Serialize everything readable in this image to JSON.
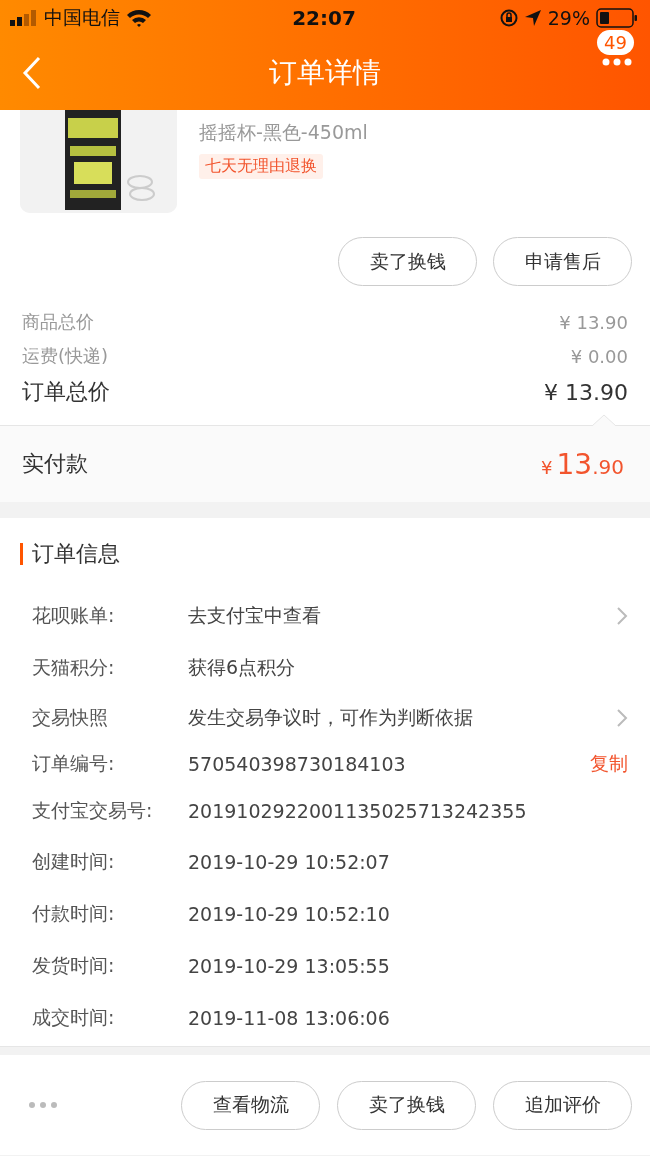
{
  "status_bar": {
    "carrier": "中国电信",
    "time": "22:07",
    "battery": "29%"
  },
  "nav": {
    "title": "订单详情",
    "badge": "49"
  },
  "product": {
    "spec": "摇摇杯-黑色-450ml",
    "tag": "七天无理由退换"
  },
  "item_buttons": [
    "卖了换钱",
    "申请售后"
  ],
  "price_rows": [
    {
      "kind": "minor",
      "label": "商品总价",
      "value": "¥ 13.90"
    },
    {
      "kind": "minor",
      "label": "运费(快递)",
      "value": "¥ 0.00"
    },
    {
      "kind": "major",
      "label": "订单总价",
      "value": "¥ 13.90"
    }
  ],
  "paid": {
    "label": "实付款",
    "currency": "¥",
    "integer": "13",
    "decimal": ".90"
  },
  "order_info": {
    "title": "订单信息",
    "rows": [
      {
        "kind": "chevron",
        "label": "花呗账单:",
        "value": "去支付宝中查看"
      },
      {
        "kind": "plain",
        "label": "天猫积分:",
        "value": "获得6点积分"
      },
      {
        "kind": "chevron",
        "label": "交易快照",
        "value": "发生交易争议时，可作为判断依据"
      },
      {
        "kind": "copy",
        "label": "订单编号:",
        "value": "570540398730184103",
        "action": "复制"
      },
      {
        "kind": "plain",
        "label": "支付宝交易号:",
        "value": "2019102922001135025713242355"
      },
      {
        "kind": "plain",
        "label": "创建时间:",
        "value": "2019-10-29 10:52:07"
      },
      {
        "kind": "plain",
        "label": "付款时间:",
        "value": "2019-10-29 10:52:10"
      },
      {
        "kind": "plain",
        "label": "发货时间:",
        "value": "2019-10-29 13:05:55"
      },
      {
        "kind": "plain",
        "label": "成交时间:",
        "value": "2019-11-08 13:06:06"
      }
    ]
  },
  "bottom_buttons": [
    "查看物流",
    "卖了换钱",
    "追加评价"
  ]
}
